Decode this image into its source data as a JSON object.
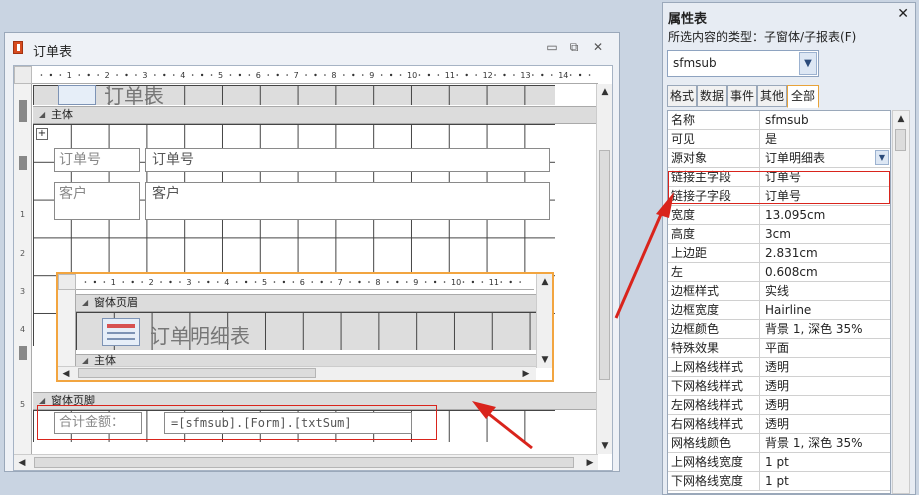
{
  "form_window": {
    "title": "订单表",
    "icon": "access-form-icon",
    "ruler_labels": [
      "1",
      "2",
      "3",
      "4",
      "5",
      "6",
      "7",
      "8",
      "9",
      "10",
      "11",
      "12",
      "13",
      "14"
    ],
    "sections": {
      "header_text": "订单表",
      "detail": "主体",
      "footer": "窗体页脚"
    },
    "fields": [
      {
        "label": "订单号",
        "textbox": "订单号"
      },
      {
        "label": "客户",
        "textbox": "客户"
      }
    ],
    "subform": {
      "ruler_labels": [
        "1",
        "2",
        "3",
        "4",
        "5",
        "6",
        "7",
        "8",
        "9",
        "10",
        "11"
      ],
      "header_section": "窗体页眉",
      "title": "订单明细表",
      "detail_section": "主体"
    },
    "footer": {
      "label": "合计金额：",
      "expression": "=[sfmsub].[Form].[txtSum]"
    }
  },
  "property_sheet": {
    "title": "属性表",
    "selection_type": "所选内容的类型：子窗体/子报表(F)",
    "selected_object": "sfmsub",
    "tabs": [
      "格式",
      "数据",
      "事件",
      "其他",
      "全部"
    ],
    "active_tab": "全部",
    "rows": [
      {
        "name": "名称",
        "value": "sfmsub"
      },
      {
        "name": "可见",
        "value": "是"
      },
      {
        "name": "源对象",
        "value": "订单明细表"
      },
      {
        "name": "链接主字段",
        "value": "订单号"
      },
      {
        "name": "链接子字段",
        "value": "订单号"
      },
      {
        "name": "宽度",
        "value": "13.095cm"
      },
      {
        "name": "高度",
        "value": "3cm"
      },
      {
        "name": "上边距",
        "value": "2.831cm"
      },
      {
        "name": "左",
        "value": "0.608cm"
      },
      {
        "name": "边框样式",
        "value": "实线"
      },
      {
        "name": "边框宽度",
        "value": "Hairline"
      },
      {
        "name": "边框颜色",
        "value": "背景 1, 深色 35%"
      },
      {
        "name": "特殊效果",
        "value": "平面"
      },
      {
        "name": "上网格线样式",
        "value": "透明"
      },
      {
        "name": "下网格线样式",
        "value": "透明"
      },
      {
        "name": "左网格线样式",
        "value": "透明"
      },
      {
        "name": "右网格线样式",
        "value": "透明"
      },
      {
        "name": "网格线颜色",
        "value": "背景 1, 深色 35%"
      },
      {
        "name": "上网格线宽度",
        "value": "1 pt"
      },
      {
        "name": "下网格线宽度",
        "value": "1 pt"
      }
    ]
  },
  "colors": {
    "highlight_red": "#d9241c",
    "subform_border": "#f2a540"
  }
}
